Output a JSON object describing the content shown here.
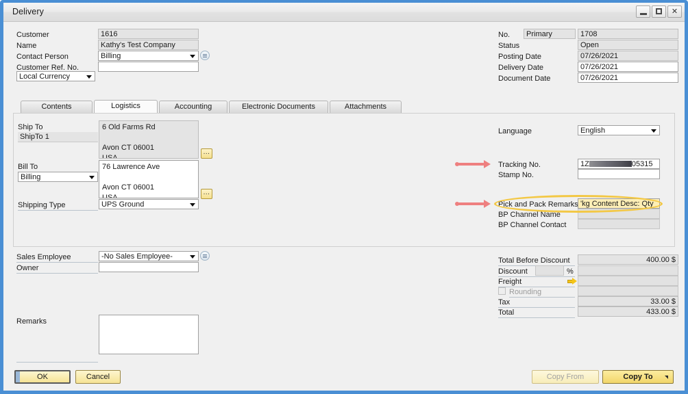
{
  "window": {
    "title": "Delivery",
    "controls": {
      "minimize": "minimize-icon",
      "maximize": "maximize-icon",
      "close": "close-icon"
    },
    "frame_color": "#4a8fd4"
  },
  "header_left": {
    "fields": [
      {
        "label": "Customer",
        "value": "1616",
        "readonly": true
      },
      {
        "label": "Name",
        "value": "Kathy's Test Company",
        "readonly": true
      },
      {
        "label": "Contact Person",
        "value": "Billing",
        "type": "combo",
        "has_link_icon": true
      },
      {
        "label": "Customer Ref. No.",
        "value": "",
        "readonly": false
      }
    ],
    "currency_selector": {
      "value": "Local Currency",
      "type": "combo"
    }
  },
  "header_right": {
    "no_label": "No.",
    "no_series": "Primary",
    "no_value": "1708",
    "fields": [
      {
        "label": "Status",
        "value": "Open",
        "readonly": true
      },
      {
        "label": "Posting Date",
        "value": "07/26/2021",
        "readonly": true
      },
      {
        "label": "Delivery Date",
        "value": "07/26/2021",
        "readonly": false
      },
      {
        "label": "Document Date",
        "value": "07/26/2021",
        "readonly": false
      }
    ]
  },
  "tabs": [
    {
      "label": "Contents",
      "active": false
    },
    {
      "label": "Logistics",
      "active": true
    },
    {
      "label": "Accounting",
      "active": false
    },
    {
      "label": "Electronic Documents",
      "active": false
    },
    {
      "label": "Attachments",
      "active": false
    }
  ],
  "logistics": {
    "ship_to": {
      "label": "Ship To",
      "code": "ShipTo 1",
      "address_line1": "6 Old Farms Rd",
      "address_line2": "",
      "address_line3": "Avon CT  06001",
      "address_line4": "USA",
      "browse_button": "..."
    },
    "bill_to": {
      "label": "Bill To",
      "code": "Billing",
      "address_line1": "76 Lawrence Ave",
      "address_line2": "",
      "address_line3": "Avon CT  06001",
      "address_line4": "USA",
      "browse_button": "..."
    },
    "shipping_type": {
      "label": "Shipping Type",
      "value": "UPS Ground"
    },
    "language": {
      "label": "Language",
      "value": "English"
    },
    "tracking_no": {
      "label": "Tracking No.",
      "prefix": "1Z",
      "suffix": "05315",
      "redacted": true
    },
    "stamp_no": {
      "label": "Stamp No.",
      "value": ""
    },
    "pick_and_pack_remarks": {
      "label": "Pick and Pack Remarks",
      "value": "'kg Content Desc:    Qty"
    },
    "bp_channel_name": {
      "label": "BP Channel Name",
      "value": ""
    },
    "bp_channel_contact": {
      "label": "BP Channel Contact",
      "value": ""
    }
  },
  "footer_left": {
    "sales_employee": {
      "label": "Sales Employee",
      "value": "-No Sales Employee-",
      "has_link_icon": true
    },
    "owner": {
      "label": "Owner",
      "value": ""
    },
    "remarks": {
      "label": "Remarks",
      "value": ""
    }
  },
  "totals": [
    {
      "label": "Total Before Discount",
      "value": "400.00 $"
    },
    {
      "label": "Discount",
      "pct_value": "",
      "pct_symbol": "%",
      "value": ""
    },
    {
      "label": "Freight",
      "value": "",
      "has_arrow": true
    },
    {
      "label": "Rounding",
      "value": "",
      "has_checkbox": true,
      "disabled": true
    },
    {
      "label": "Tax",
      "value": "33.00 $"
    },
    {
      "label": "Total",
      "value": "433.00 $"
    }
  ],
  "buttons": {
    "ok": "OK",
    "cancel": "Cancel",
    "copy_from": "Copy From",
    "copy_to": "Copy To"
  },
  "annotations": {
    "arrow_color": "#ee8080",
    "highlight_color": "#f3c845",
    "arrow_tracking_target": "Tracking No.",
    "arrow_remarks_target": "Pick and Pack Remarks"
  }
}
